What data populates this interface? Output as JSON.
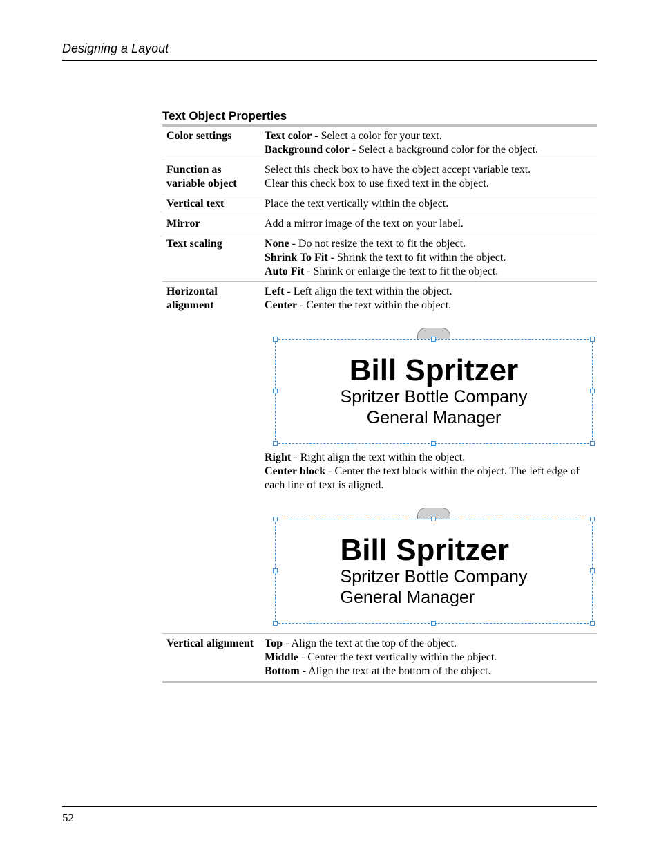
{
  "header": {
    "title": "Designing a Layout"
  },
  "table": {
    "title": "Text Object Properties",
    "rows": {
      "color": {
        "name": "Color settings",
        "textcolor_label": "Text color",
        "textcolor_desc": " - Select a color for your text.",
        "bgcolor_label": "Background color",
        "bgcolor_desc": " - Select a background color for the object."
      },
      "variable": {
        "name": "Function as variable object",
        "line1": "Select this check box to have the object accept variable text.",
        "line2": "Clear this check box to use fixed text in the object."
      },
      "vertical_text": {
        "name": "Vertical text",
        "desc": "Place the text vertically within the object."
      },
      "mirror": {
        "name": "Mirror",
        "desc": "Add a mirror image of the text on your label."
      },
      "scaling": {
        "name": "Text scaling",
        "none_label": "None",
        "none_desc": " - Do not resize the text to fit the object.",
        "shrink_label": "Shrink To Fit",
        "shrink_desc": " - Shrink the text to fit within the object.",
        "auto_label": "Auto Fit",
        "auto_desc": " - Shrink or enlarge the text to fit the object."
      },
      "halign": {
        "name": "Horizontal alignment",
        "left_label": "Left",
        "left_desc": " - Left align the text within the object.",
        "center_label": "Center",
        "center_desc": " - Center the text within the object.",
        "right_label": "Right",
        "right_desc": " - Right align the text within the object.",
        "cblock_label": "Center block",
        "cblock_desc": " - Center the text block within the object. The left edge of each line of text is aligned."
      },
      "valign": {
        "name": "Vertical alignment",
        "top_label": "Top",
        "top_desc": " - Align the text at the top of the object.",
        "middle_label": "Middle",
        "middle_desc": " - Center the text vertically within the object.",
        "bottom_label": "Bottom",
        "bottom_desc": " - Align the text at the bottom of the object."
      }
    }
  },
  "label_sample": {
    "name": "Bill Spritzer",
    "company": "Spritzer Bottle Company",
    "title": "General Manager"
  },
  "footer": {
    "page": "52"
  }
}
